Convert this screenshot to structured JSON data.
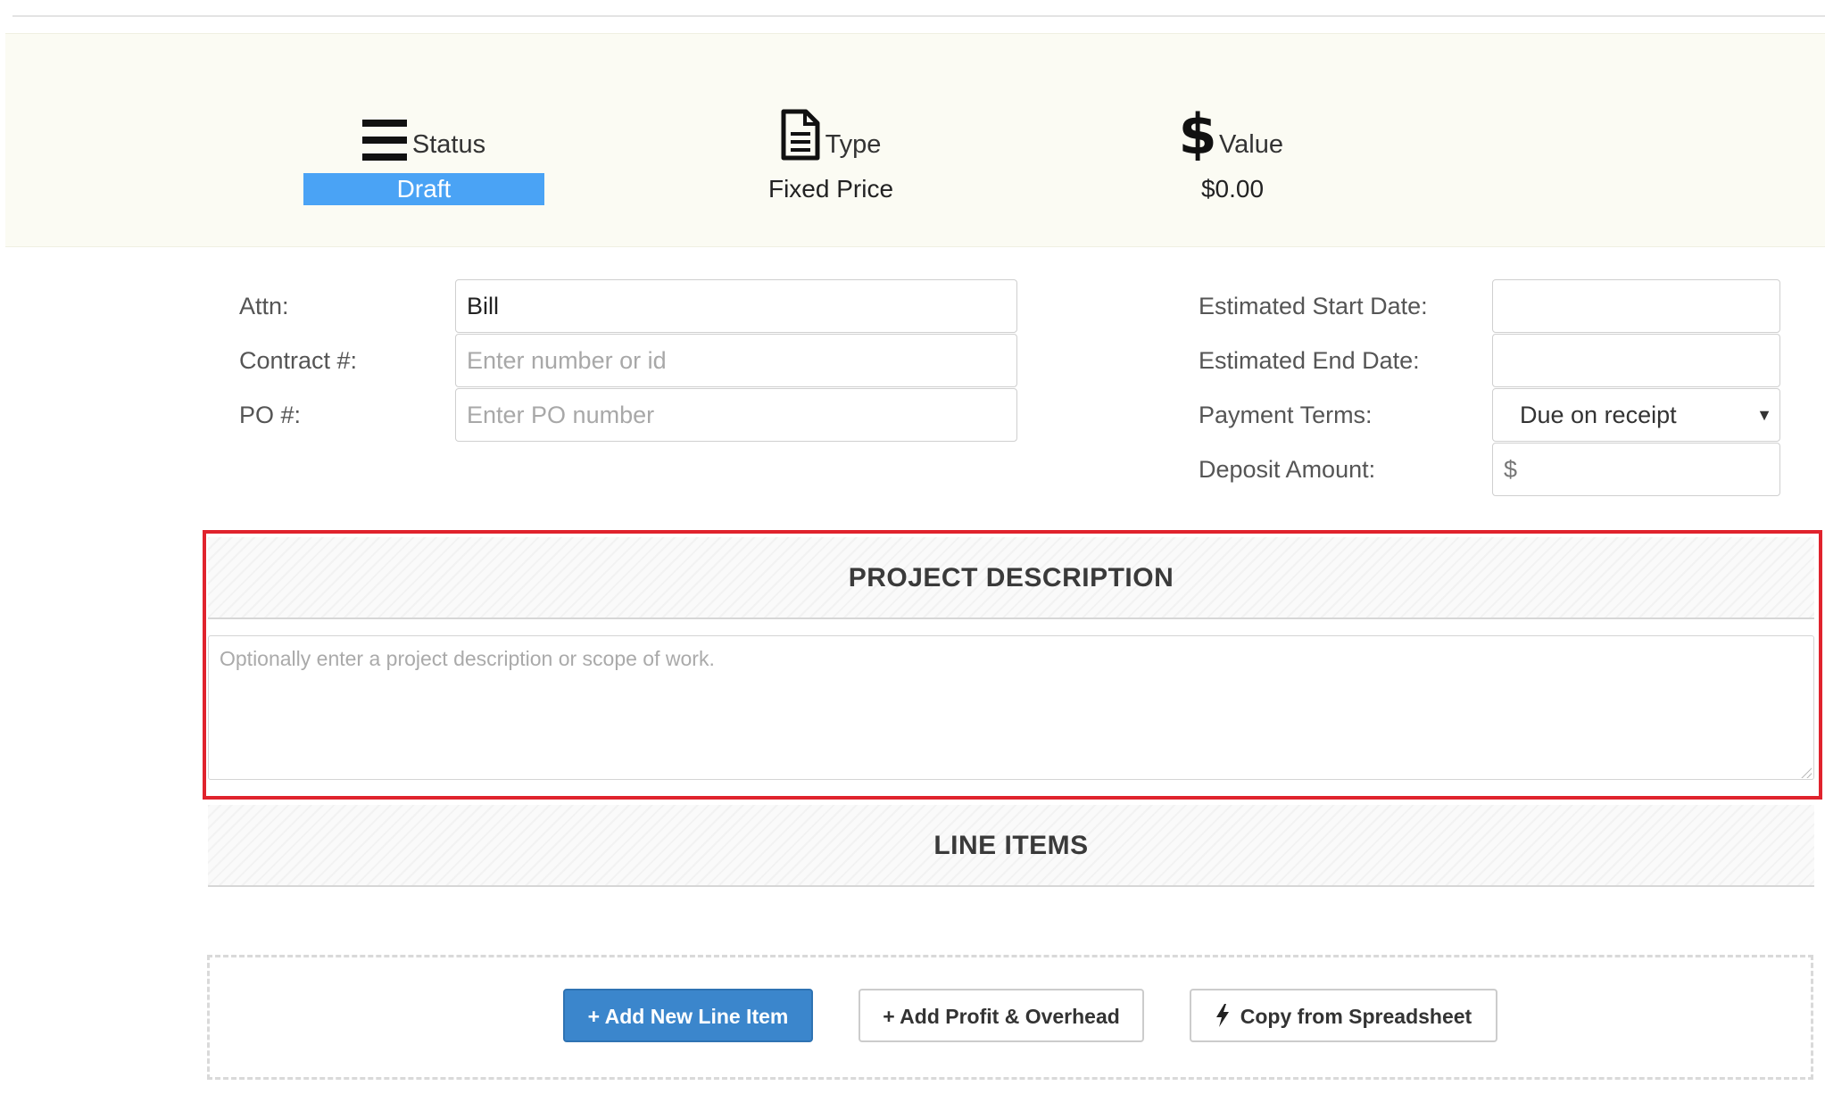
{
  "summary": {
    "status": {
      "label": "Status",
      "value": "Draft",
      "icon": "hamburger-menu-icon"
    },
    "type": {
      "label": "Type",
      "value": "Fixed Price",
      "icon": "document-icon"
    },
    "value": {
      "label": "Value",
      "value": "$0.00",
      "icon": "dollar-icon"
    }
  },
  "colors": {
    "status_badge": "#4aa3f5",
    "primary_button": "#3b86cc",
    "highlight_border": "#e0232d",
    "banner_bg": "#fbfbf3"
  },
  "form": {
    "attn": {
      "label": "Attn:",
      "value": "Bill"
    },
    "contract": {
      "label": "Contract #:",
      "placeholder": "Enter number or id"
    },
    "po": {
      "label": "PO #:",
      "placeholder": "Enter PO number"
    },
    "start_date": {
      "label": "Estimated Start Date:",
      "value": ""
    },
    "end_date": {
      "label": "Estimated End Date:",
      "value": ""
    },
    "payment_terms": {
      "label": "Payment Terms:",
      "value": "Due on receipt"
    },
    "deposit": {
      "label": "Deposit Amount:",
      "prefix": "$",
      "value": ""
    }
  },
  "project_description": {
    "heading": "PROJECT DESCRIPTION",
    "placeholder": "Optionally enter a project description or scope of work."
  },
  "line_items": {
    "heading": "LINE ITEMS",
    "add_item_label": "+ Add New Line Item",
    "add_profit_label": "+ Add Profit & Overhead",
    "copy_label": "Copy from Spreadsheet",
    "copy_icon": "lightning-bolt-icon"
  }
}
